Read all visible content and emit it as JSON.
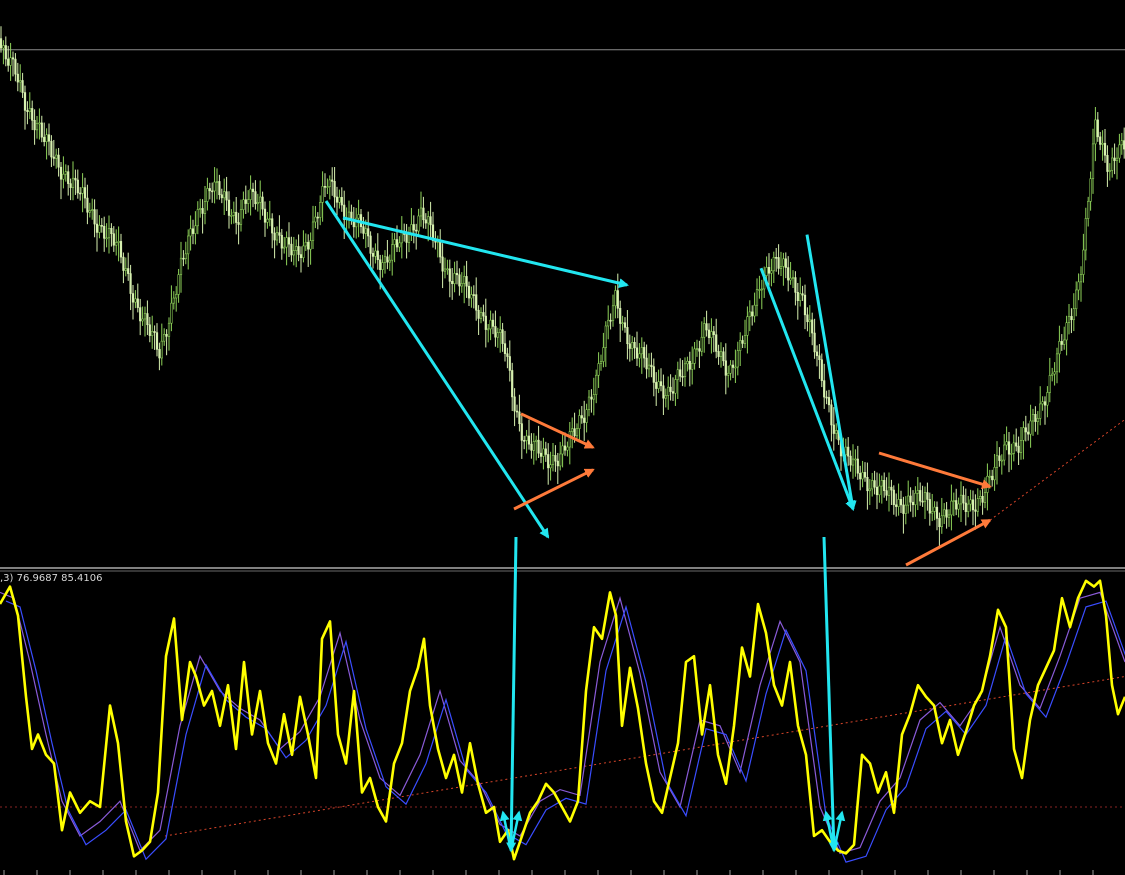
{
  "indicator": {
    "label": ",3) 76.9687 85.4106"
  },
  "colors": {
    "background": "#000000",
    "candle_up": "#8fd35a",
    "candle_down": "#d7f1b0",
    "stoch_main": "#ffff00",
    "stoch_signal_a": "#3a4dff",
    "stoch_signal_b": "#8a5bd8",
    "arrow_cyan": "#22e6f0",
    "arrow_orange": "#ff7a3a",
    "trend_dotted": "#d8452a",
    "level_line": "#8a2525",
    "separator": "#ffffff",
    "hline": "#8a8a8a"
  },
  "chart_data": [
    {
      "type": "candlestick",
      "title": "",
      "xlabel": "",
      "ylabel": "",
      "ylim": [
        0,
        100
      ],
      "grid": false,
      "legend": "none",
      "close_path": [
        [
          0,
          94
        ],
        [
          8,
          90
        ],
        [
          18,
          88
        ],
        [
          30,
          82
        ],
        [
          45,
          76
        ],
        [
          60,
          72
        ],
        [
          75,
          68
        ],
        [
          90,
          64
        ],
        [
          105,
          60
        ],
        [
          118,
          57
        ],
        [
          130,
          52
        ],
        [
          140,
          46
        ],
        [
          150,
          42
        ],
        [
          162,
          38
        ],
        [
          172,
          45
        ],
        [
          182,
          52
        ],
        [
          192,
          58
        ],
        [
          202,
          64
        ],
        [
          214,
          68
        ],
        [
          226,
          65
        ],
        [
          238,
          62
        ],
        [
          250,
          66
        ],
        [
          262,
          64
        ],
        [
          274,
          61
        ],
        [
          286,
          57
        ],
        [
          298,
          55
        ],
        [
          310,
          58
        ],
        [
          320,
          63
        ],
        [
          330,
          68
        ],
        [
          340,
          66
        ],
        [
          352,
          62
        ],
        [
          364,
          60
        ],
        [
          376,
          56
        ],
        [
          388,
          54
        ],
        [
          400,
          57
        ],
        [
          412,
          60
        ],
        [
          424,
          63
        ],
        [
          436,
          58
        ],
        [
          448,
          53
        ],
        [
          460,
          51
        ],
        [
          472,
          48
        ],
        [
          484,
          45
        ],
        [
          496,
          42
        ],
        [
          508,
          38
        ],
        [
          518,
          28
        ],
        [
          528,
          22
        ],
        [
          540,
          20
        ],
        [
          552,
          19
        ],
        [
          565,
          20
        ],
        [
          576,
          23
        ],
        [
          588,
          28
        ],
        [
          600,
          34
        ],
        [
          610,
          42
        ],
        [
          618,
          48
        ],
        [
          626,
          43
        ],
        [
          636,
          38
        ],
        [
          648,
          36
        ],
        [
          660,
          33
        ],
        [
          672,
          30
        ],
        [
          684,
          34
        ],
        [
          696,
          38
        ],
        [
          708,
          42
        ],
        [
          720,
          38
        ],
        [
          732,
          35
        ],
        [
          744,
          39
        ],
        [
          756,
          46
        ],
        [
          765,
          52
        ],
        [
          775,
          54
        ],
        [
          790,
          52
        ],
        [
          805,
          48
        ],
        [
          815,
          40
        ],
        [
          825,
          32
        ],
        [
          835,
          26
        ],
        [
          845,
          20
        ],
        [
          858,
          17
        ],
        [
          872,
          15
        ],
        [
          886,
          13
        ],
        [
          900,
          11
        ],
        [
          914,
          12
        ],
        [
          928,
          11
        ],
        [
          942,
          9
        ],
        [
          956,
          10
        ],
        [
          970,
          11
        ],
        [
          984,
          12
        ],
        [
          996,
          16
        ],
        [
          1008,
          22
        ],
        [
          1020,
          21
        ],
        [
          1032,
          24
        ],
        [
          1044,
          29
        ],
        [
          1056,
          35
        ],
        [
          1068,
          41
        ],
        [
          1078,
          48
        ],
        [
          1086,
          57
        ],
        [
          1092,
          68
        ],
        [
          1098,
          78
        ],
        [
          1104,
          74
        ],
        [
          1112,
          71
        ],
        [
          1120,
          75
        ]
      ],
      "annotations": [
        {
          "kind": "arrow",
          "color": "cyan",
          "from": [
            343,
            62
          ],
          "to": [
            627,
            50
          ]
        },
        {
          "kind": "arrow",
          "color": "cyan",
          "from": [
            326,
            65
          ],
          "to": [
            548,
            5
          ]
        },
        {
          "kind": "arrow",
          "color": "orange",
          "from": [
            521,
            27
          ],
          "to": [
            593,
            21
          ]
        },
        {
          "kind": "arrow",
          "color": "orange",
          "from": [
            514,
            10
          ],
          "to": [
            593,
            17
          ]
        },
        {
          "kind": "arrow",
          "color": "cyan",
          "from": [
            761,
            53
          ],
          "to": [
            853,
            10
          ]
        },
        {
          "kind": "arrow",
          "color": "cyan",
          "from": [
            807,
            59
          ],
          "to": [
            853,
            10
          ]
        },
        {
          "kind": "arrow",
          "color": "orange",
          "from": [
            879,
            20
          ],
          "to": [
            990,
            14
          ]
        },
        {
          "kind": "arrow",
          "color": "orange",
          "from": [
            906,
            0
          ],
          "to": [
            990,
            8
          ]
        },
        {
          "kind": "hline",
          "y": 92
        },
        {
          "kind": "dotted_trend",
          "from": [
            990,
            8
          ],
          "to": [
            1125,
            26
          ]
        }
      ]
    },
    {
      "type": "line",
      "title": "",
      "xlabel": "",
      "ylabel": "",
      "ylim": [
        0,
        100
      ],
      "grid": false,
      "legend": "none",
      "series": [
        {
          "role": "main",
          "x": [
            0,
            10,
            18,
            26,
            32,
            38,
            46,
            54,
            62,
            70,
            80,
            90,
            100,
            110,
            118,
            126,
            134,
            142,
            150,
            158,
            166,
            174,
            182,
            190,
            196,
            204,
            212,
            220,
            228,
            236,
            244,
            252,
            260,
            268,
            276,
            284,
            292,
            300,
            308,
            316,
            322,
            330,
            338,
            346,
            354,
            362,
            370,
            378,
            386,
            394,
            402,
            410,
            418,
            424,
            430,
            438,
            446,
            454,
            462,
            470,
            478,
            486,
            494,
            500,
            508,
            514,
            522,
            530,
            538,
            546,
            554,
            562,
            570,
            578,
            586,
            594,
            602,
            610,
            616,
            622,
            630,
            638,
            646,
            654,
            662,
            670,
            678,
            686,
            694,
            702,
            710,
            718,
            726,
            734,
            742,
            750,
            758,
            766,
            774,
            782,
            790,
            798,
            806,
            814,
            822,
            830,
            838,
            846,
            854,
            862,
            870,
            878,
            886,
            894,
            902,
            910,
            918,
            926,
            934,
            942,
            950,
            958,
            966,
            974,
            982,
            990,
            998,
            1006,
            1014,
            1022,
            1030,
            1038,
            1046,
            1054,
            1062,
            1070,
            1078,
            1086,
            1094,
            1100,
            1106,
            1112,
            1118,
            1125
          ],
          "values": [
            90,
            96,
            86,
            58,
            40,
            45,
            38,
            35,
            12,
            25,
            18,
            22,
            20,
            55,
            42,
            15,
            3,
            5,
            8,
            25,
            72,
            85,
            50,
            70,
            65,
            55,
            60,
            48,
            62,
            40,
            70,
            45,
            60,
            42,
            35,
            52,
            38,
            58,
            45,
            30,
            78,
            84,
            45,
            35,
            60,
            25,
            30,
            20,
            15,
            35,
            42,
            60,
            68,
            78,
            55,
            40,
            30,
            38,
            25,
            42,
            28,
            18,
            20,
            8,
            12,
            2,
            10,
            18,
            22,
            28,
            25,
            20,
            15,
            22,
            60,
            82,
            78,
            94,
            86,
            48,
            68,
            54,
            35,
            22,
            18,
            30,
            42,
            70,
            72,
            45,
            62,
            38,
            28,
            48,
            75,
            65,
            90,
            80,
            62,
            55,
            70,
            48,
            38,
            10,
            12,
            8,
            5,
            4,
            7,
            38,
            35,
            25,
            32,
            18,
            45,
            52,
            62,
            58,
            55,
            42,
            50,
            38,
            46,
            55,
            60,
            72,
            88,
            82,
            40,
            30,
            50,
            62,
            68,
            74,
            92,
            82,
            92,
            98,
            96,
            98,
            86,
            62,
            52,
            58
          ]
        },
        {
          "role": "signal",
          "x": [
            0,
            14,
            30,
            46,
            62,
            80,
            100,
            120,
            140,
            160,
            180,
            200,
            220,
            240,
            260,
            280,
            300,
            320,
            340,
            360,
            380,
            400,
            420,
            440,
            460,
            480,
            500,
            520,
            540,
            560,
            580,
            600,
            620,
            640,
            660,
            680,
            700,
            720,
            740,
            760,
            780,
            800,
            820,
            840,
            860,
            880,
            900,
            920,
            940,
            960,
            980,
            1000,
            1020,
            1040,
            1060,
            1080,
            1100,
            1125
          ],
          "values": [
            94,
            92,
            70,
            45,
            22,
            10,
            15,
            22,
            5,
            12,
            48,
            72,
            60,
            54,
            50,
            40,
            46,
            58,
            80,
            50,
            30,
            24,
            38,
            60,
            36,
            28,
            14,
            10,
            22,
            26,
            24,
            70,
            92,
            66,
            32,
            20,
            50,
            48,
            32,
            62,
            84,
            70,
            20,
            4,
            6,
            22,
            30,
            50,
            56,
            48,
            58,
            82,
            62,
            54,
            72,
            92,
            94,
            70
          ]
        }
      ],
      "annotations": [
        {
          "kind": "level",
          "y": 20
        },
        {
          "kind": "arrow",
          "color": "cyan",
          "from": [
            516,
            100
          ],
          "to": [
            511,
            5
          ]
        },
        {
          "kind": "arrow",
          "color": "cyan",
          "from": [
            824,
            100
          ],
          "to": [
            834,
            5
          ]
        },
        {
          "kind": "dotted_trend",
          "from": [
            165,
            10
          ],
          "to": [
            1125,
            65
          ]
        }
      ]
    }
  ]
}
